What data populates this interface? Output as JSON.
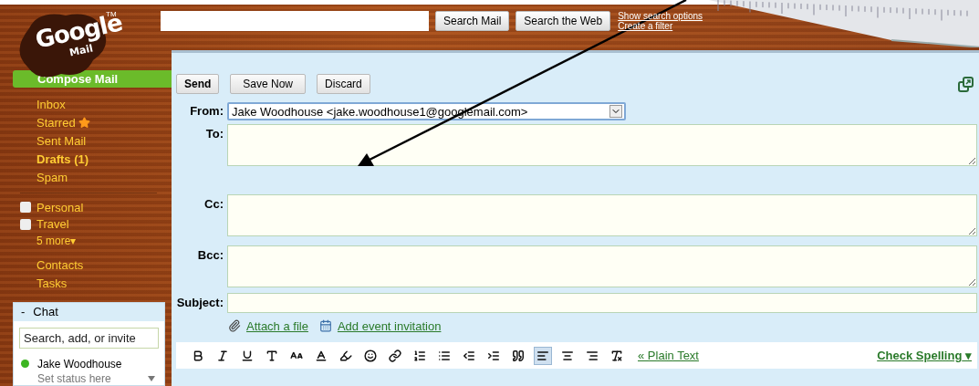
{
  "logo": {
    "word": "Google",
    "sub": "Mail",
    "tm": "TM"
  },
  "search": {
    "buttons": [
      "Search Mail",
      "Search the Web"
    ],
    "links": [
      "Show search options",
      "Create a filter"
    ]
  },
  "compose_button": "Compose Mail",
  "nav": [
    {
      "label": "Inbox",
      "kind": "plain",
      "unread": false
    },
    {
      "label": "Starred",
      "kind": "starred",
      "unread": false
    },
    {
      "label": "Sent Mail",
      "kind": "plain",
      "unread": false
    },
    {
      "label": "Drafts (1)",
      "kind": "plain",
      "unread": true
    },
    {
      "label": "Spam",
      "kind": "plain",
      "unread": false
    }
  ],
  "labels": {
    "items": [
      "Personal",
      "Travel"
    ],
    "more": "5 more",
    "more_caret": "▾"
  },
  "extra_links": [
    "Contacts",
    "Tasks"
  ],
  "chat": {
    "title": "Chat",
    "toggle": "-",
    "placeholder": "Search, add, or invite",
    "contacts": [
      {
        "name": "Jake Woodhouse",
        "status": "Set status here",
        "color": "#3cb521"
      }
    ]
  },
  "compose": {
    "actions": [
      "Send",
      "Save Now",
      "Discard"
    ],
    "from": {
      "label": "From:",
      "value": "Jake Woodhouse <jake.woodhouse1@googlemail.com>"
    },
    "fields": [
      {
        "label": "To:",
        "kind": "area"
      },
      {
        "label": "Cc:",
        "kind": "area"
      },
      {
        "label": "Bcc:",
        "kind": "area"
      },
      {
        "label": "Subject:",
        "kind": "line"
      }
    ],
    "attach": "Attach a file",
    "event": "Add event invitation",
    "toolbar": [
      {
        "kind": "bold",
        "selected": false
      },
      {
        "kind": "italic",
        "selected": false
      },
      {
        "kind": "underline",
        "selected": false
      },
      {
        "kind": "font",
        "selected": false
      },
      {
        "kind": "size",
        "selected": false
      },
      {
        "kind": "color",
        "selected": false
      },
      {
        "kind": "highlight",
        "selected": false
      },
      {
        "kind": "emoticon",
        "selected": false
      },
      {
        "kind": "link",
        "selected": false
      },
      {
        "kind": "numbered",
        "selected": false
      },
      {
        "kind": "bulleted",
        "selected": false
      },
      {
        "kind": "outdent",
        "selected": false
      },
      {
        "kind": "indent",
        "selected": false
      },
      {
        "kind": "quote",
        "selected": false
      },
      {
        "kind": "left",
        "selected": true
      },
      {
        "kind": "center",
        "selected": false
      },
      {
        "kind": "right",
        "selected": false
      },
      {
        "kind": "clear",
        "selected": false
      }
    ],
    "plain_text": "« Plain Text",
    "spelling": "Check Spelling",
    "spelling_caret": "▾"
  }
}
